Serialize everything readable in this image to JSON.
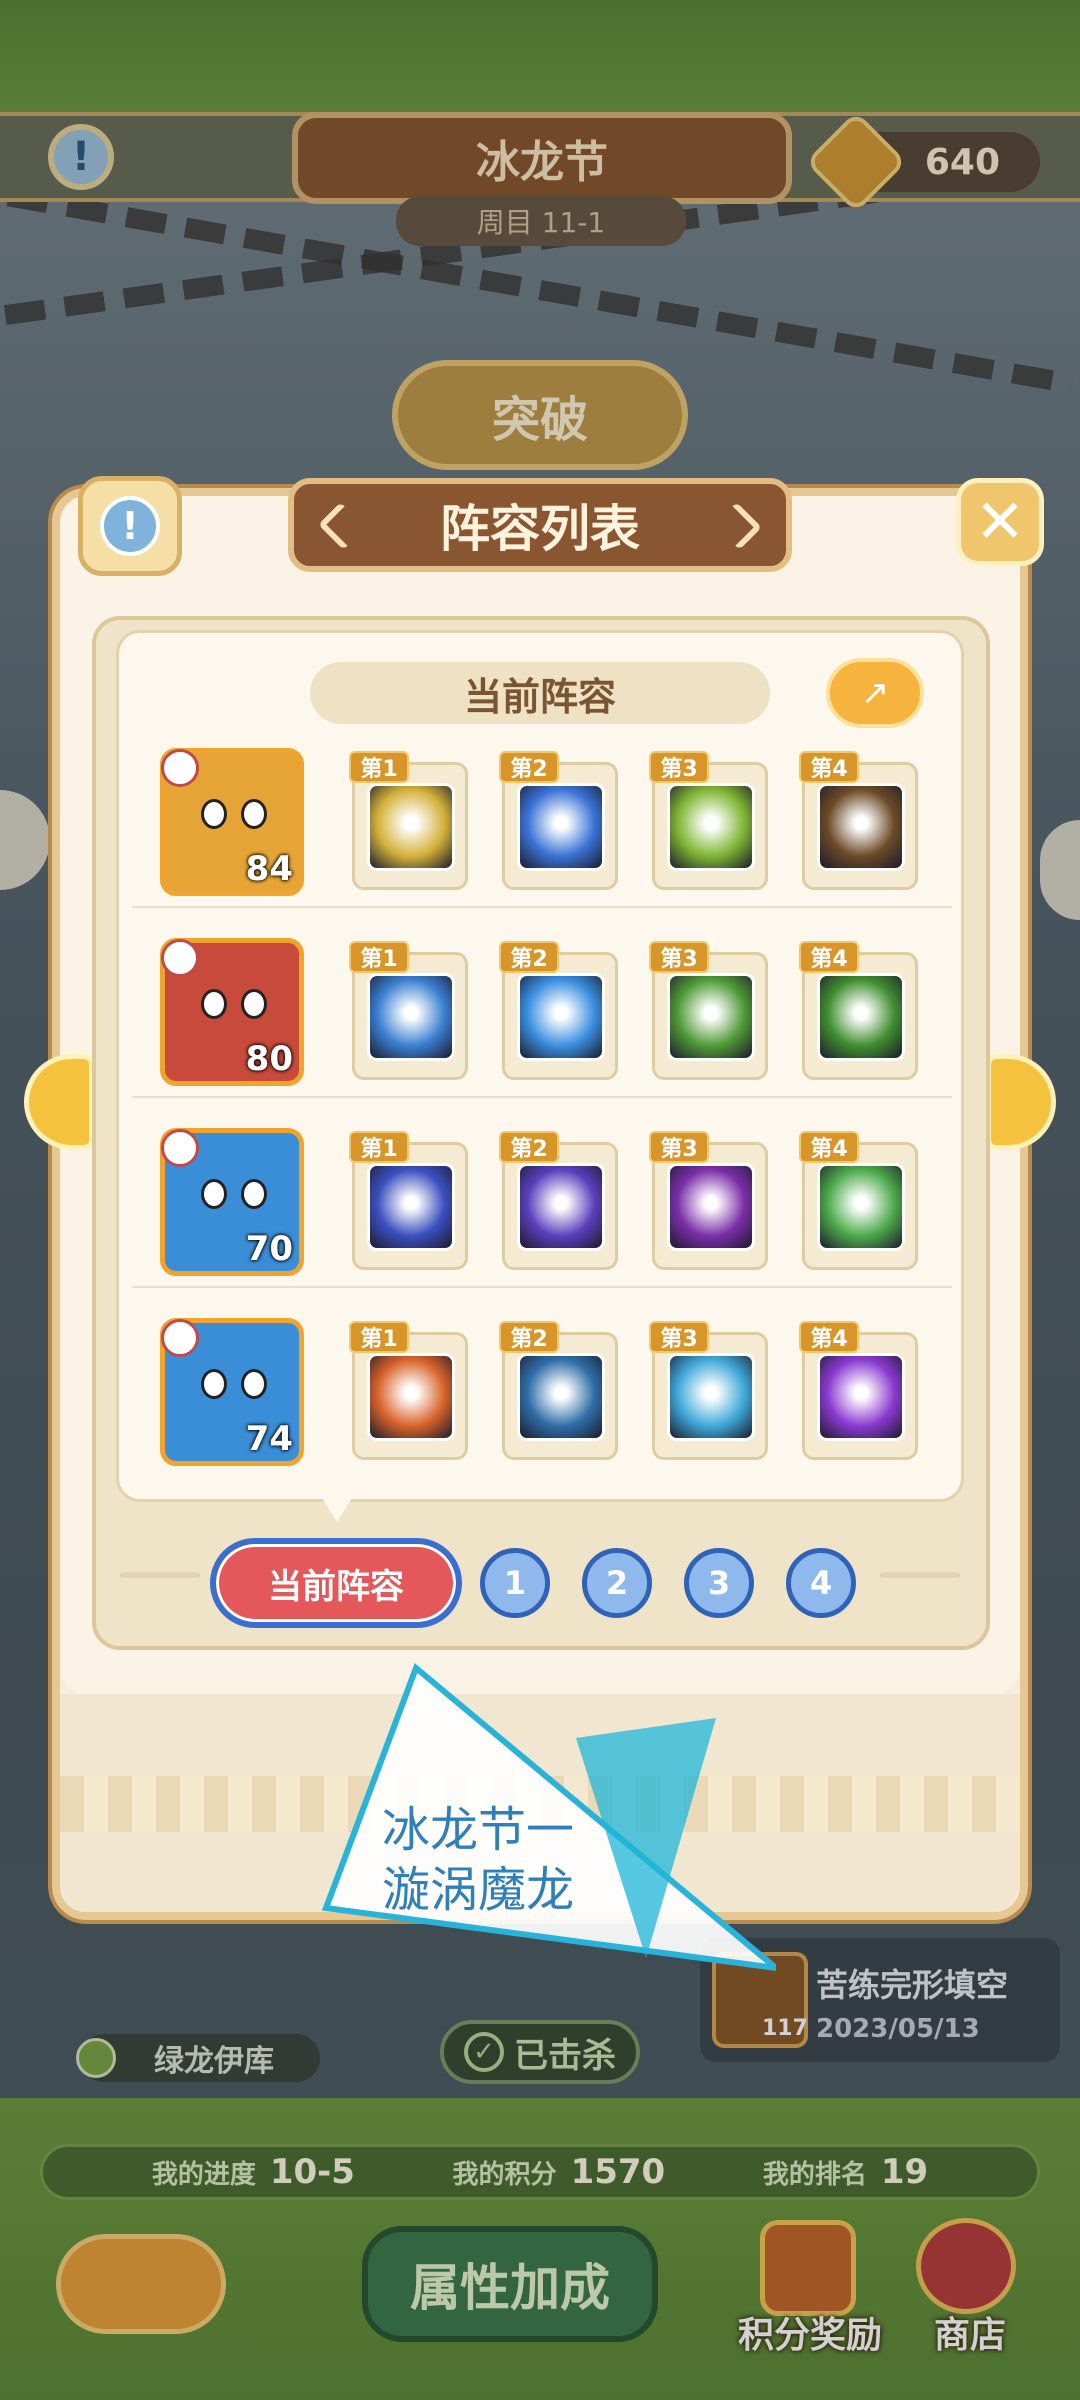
{
  "event": {
    "title": "冰龙节",
    "subtitle": "周目 11-1",
    "coins": "640"
  },
  "top": {
    "breach_label": "突破"
  },
  "dialog": {
    "title": "阵容列表",
    "current_header": "当前阵容",
    "rows": [
      {
        "level": "84",
        "hero_color": "#e6a436",
        "skills": [
          {
            "tag": "第1",
            "color": "#d4b13a"
          },
          {
            "tag": "第2",
            "color": "#3a73d6"
          },
          {
            "tag": "第3",
            "color": "#7fb534"
          },
          {
            "tag": "第4",
            "color": "#6c4a26"
          }
        ]
      },
      {
        "level": "80",
        "hero_color": "#c84a3a",
        "skills": [
          {
            "tag": "第1",
            "color": "#3a7fd0"
          },
          {
            "tag": "第2",
            "color": "#3a8ee0"
          },
          {
            "tag": "第3",
            "color": "#4e9a36"
          },
          {
            "tag": "第4",
            "color": "#3f8e2e"
          }
        ]
      },
      {
        "level": "70",
        "hero_color": "#3a8ed8",
        "skills": [
          {
            "tag": "第1",
            "color": "#3b4fbf"
          },
          {
            "tag": "第2",
            "color": "#5a3fbd"
          },
          {
            "tag": "第3",
            "color": "#7a2fa8"
          },
          {
            "tag": "第4",
            "color": "#4caa4a"
          }
        ]
      },
      {
        "level": "74",
        "hero_color": "#3a8ed8",
        "skills": [
          {
            "tag": "第1",
            "color": "#d8632a"
          },
          {
            "tag": "第2",
            "color": "#2f6ea8"
          },
          {
            "tag": "第3",
            "color": "#3fa8d8"
          },
          {
            "tag": "第4",
            "color": "#8a3ad0"
          }
        ]
      }
    ],
    "pager": {
      "current_label": "当前阵容",
      "pages": [
        "1",
        "2",
        "3",
        "4"
      ]
    }
  },
  "behind": {
    "boss_name": "绿龙伊库",
    "killed_label": "已击杀",
    "record_title": "苦练完形填空",
    "record_date": "2023/05/13",
    "record_level": "117"
  },
  "bottom": {
    "progress_label": "我的进度",
    "progress_value": "10-5",
    "score_label": "我的积分",
    "score_value": "1570",
    "rank_label": "我的排名",
    "rank_value": "19",
    "attr_label": "属性加成",
    "reward_label": "积分奖励",
    "shop_label": "商店"
  },
  "watermark": {
    "line1": "冰龙节一",
    "line2": "漩涡魔龙"
  },
  "colors": {
    "accent": "#8a5632",
    "tab_active": "#e4575b",
    "page_dot": "#8fb9ec"
  }
}
